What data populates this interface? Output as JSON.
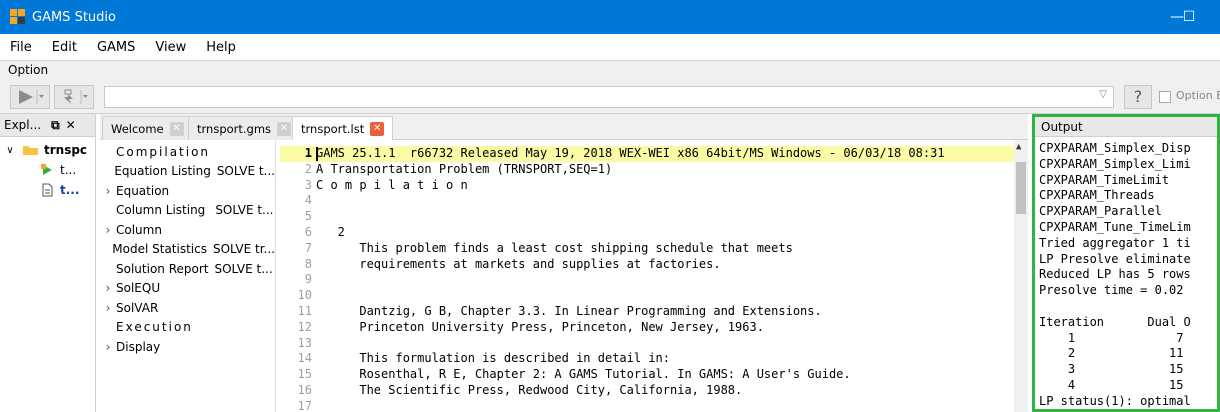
{
  "window": {
    "title": "GAMS Studio",
    "minimize_glyph": "—",
    "maximize_glyph": "☐"
  },
  "menu": [
    "File",
    "Edit",
    "GAMS",
    "View",
    "Help"
  ],
  "option_bar": {
    "label": "Option",
    "input_value": "",
    "help_glyph": "?",
    "editor_checkbox_label": "Option Ec"
  },
  "explorer": {
    "title": "Expl...",
    "tree": [
      {
        "label": "trnspc",
        "type": "folder",
        "expanded": true
      },
      {
        "label": "t...",
        "type": "run-file"
      },
      {
        "label": "t...",
        "type": "file"
      }
    ]
  },
  "tabs": [
    {
      "label": "Welcome",
      "active": false
    },
    {
      "label": "trnsport.gms",
      "active": false
    },
    {
      "label": "trnsport.lst",
      "active": true
    }
  ],
  "lst_navigator": [
    {
      "label": "Compilation",
      "chevron": false,
      "spaced": true
    },
    {
      "label": "Equation Listing",
      "detail": "SOLVE t...",
      "chevron": false
    },
    {
      "label": "Equation",
      "chevron": true
    },
    {
      "label": "Column Listing",
      "detail": "SOLVE t...",
      "chevron": false
    },
    {
      "label": "Column",
      "chevron": true
    },
    {
      "label": "Model Statistics",
      "detail": "SOLVE tr...",
      "chevron": false
    },
    {
      "label": "Solution Report",
      "detail": "SOLVE t...",
      "chevron": false
    },
    {
      "label": "SolEQU",
      "chevron": true
    },
    {
      "label": "SolVAR",
      "chevron": true
    },
    {
      "label": "Execution",
      "chevron": false,
      "spaced": true
    },
    {
      "label": "Display",
      "chevron": true
    }
  ],
  "editor": {
    "current_line": 1,
    "lines": [
      {
        "n": "1",
        "text": "GAMS 25.1.1  r66732 Released May 19, 2018 WEX-WEI x86 64bit/MS Windows - 06/03/18 08:31"
      },
      {
        "n": "2",
        "text": "A Transportation Problem (TRNSPORT,SEQ=1)"
      },
      {
        "n": "3",
        "text": "C o m p i l a t i o n"
      },
      {
        "n": "4",
        "text": ""
      },
      {
        "n": "5",
        "text": ""
      },
      {
        "n": "6",
        "text": "   2"
      },
      {
        "n": "7",
        "text": "      This problem finds a least cost shipping schedule that meets"
      },
      {
        "n": "8",
        "text": "      requirements at markets and supplies at factories."
      },
      {
        "n": "9",
        "text": ""
      },
      {
        "n": "10",
        "text": ""
      },
      {
        "n": "11",
        "text": "      Dantzig, G B, Chapter 3.3. In Linear Programming and Extensions."
      },
      {
        "n": "12",
        "text": "      Princeton University Press, Princeton, New Jersey, 1963."
      },
      {
        "n": "13",
        "text": ""
      },
      {
        "n": "14",
        "text": "      This formulation is described in detail in:"
      },
      {
        "n": "15",
        "text": "      Rosenthal, R E, Chapter 2: A GAMS Tutorial. In GAMS: A User's Guide."
      },
      {
        "n": "16",
        "text": "      The Scientific Press, Redwood City, California, 1988."
      },
      {
        "n": "17",
        "text": ""
      }
    ]
  },
  "output": {
    "title": "Output",
    "lines": [
      "CPXPARAM_Simplex_Disp",
      "CPXPARAM_Simplex_Limi",
      "CPXPARAM_TimeLimit",
      "CPXPARAM_Threads",
      "CPXPARAM_Parallel",
      "CPXPARAM_Tune_TimeLim",
      "Tried aggregator 1 ti",
      "LP Presolve eliminate",
      "Reduced LP has 5 rows",
      "Presolve time = 0.02",
      "",
      "Iteration      Dual O",
      "    1              7",
      "    2             11",
      "    3             15",
      "    4             15",
      "LP status(1): optimal"
    ]
  },
  "colors": {
    "titlebar": "#0078d7",
    "current_line_highlight": "#fbfaa5",
    "output_border": "#2fb53f",
    "active_tab_close": "#e8603c"
  }
}
